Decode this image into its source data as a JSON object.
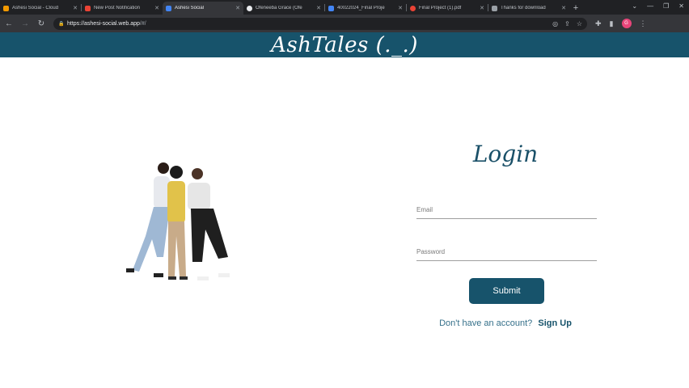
{
  "browser": {
    "tabs": [
      {
        "title": "Ashesi Social - Cloud",
        "favicon_color": "#f29900",
        "active": false
      },
      {
        "title": "New Post Notification",
        "favicon_color": "#ea4335",
        "active": false
      },
      {
        "title": "Ashesi Social",
        "favicon_color": "#4285f4",
        "active": true
      },
      {
        "title": "Ofeneeba Grace (Ofe",
        "favicon_color": "#e8eaed",
        "active": false
      },
      {
        "title": "40022024_Final Proje",
        "favicon_color": "#4285f4",
        "active": false
      },
      {
        "title": "Final Project (1).pdf",
        "favicon_color": "#ea4335",
        "active": false
      },
      {
        "title": "Thanks for download",
        "favicon_color": "#9aa0a6",
        "active": false
      }
    ],
    "new_tab_label": "+",
    "url_host": "https://ashesi-social.web.app",
    "url_path": "/#/",
    "profile_initial": "G"
  },
  "app": {
    "title": "AshTales (._.)"
  },
  "login": {
    "heading": "Login",
    "email_placeholder": "Email",
    "password_placeholder": "Password",
    "submit_label": "Submit",
    "signup_prompt": "Don't have an account?",
    "signup_link": "Sign Up"
  },
  "colors": {
    "brand": "#17536b",
    "brand_text": "#1a5068"
  }
}
